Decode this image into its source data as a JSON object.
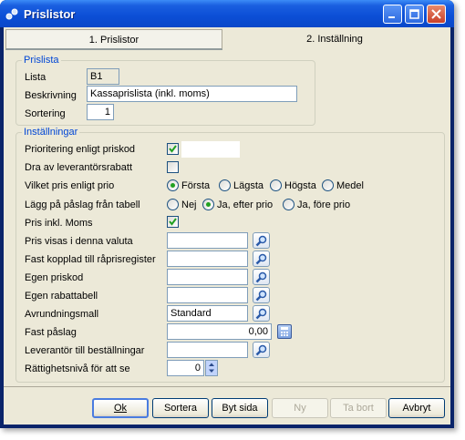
{
  "window": {
    "title": "Prislistor"
  },
  "tabs": [
    {
      "label": "1. Prislistor",
      "selected": false
    },
    {
      "label": "2. Inställning",
      "selected": true
    }
  ],
  "prislista": {
    "group_title": "Prislista",
    "lista_label": "Lista",
    "lista_value": "B1",
    "beskrivning_label": "Beskrivning",
    "beskrivning_value": "Kassaprislista (inkl. moms)",
    "sortering_label": "Sortering",
    "sortering_value": "1"
  },
  "installningar": {
    "group_title": "Inställningar",
    "prioritering_label": "Prioritering enligt priskod",
    "prioritering_checked": true,
    "leverantorsrabatt_label": "Dra av leverantörsrabatt",
    "leverantorsrabatt_checked": false,
    "vilket_pris_label": "Vilket pris enligt prio",
    "vilket_pris_options": [
      "Första",
      "Lägsta",
      "Högsta",
      "Medel"
    ],
    "vilket_pris_selected": "Första",
    "lagg_pa_label": "Lägg på påslag från tabell",
    "lagg_pa_options": [
      "Nej",
      "Ja, efter prio",
      "Ja, före prio"
    ],
    "lagg_pa_selected": "Ja, efter prio",
    "pris_inkl_moms_label": "Pris inkl. Moms",
    "pris_inkl_moms_checked": true,
    "valuta_label": "Pris visas i denna valuta",
    "valuta_value": "",
    "raprisregister_label": "Fast kopplad till råprisregister",
    "raprisregister_value": "",
    "egen_priskod_label": "Egen priskod",
    "egen_priskod_value": "",
    "egen_rabattabell_label": "Egen rabattabell",
    "egen_rabattabell_value": "",
    "avrundningsmall_label": "Avrundningsmall",
    "avrundningsmall_value": "Standard",
    "fast_paslag_label": "Fast påslag",
    "fast_paslag_value": "0,00",
    "leverantor_label": "Leverantör till beställningar",
    "leverantor_value": "",
    "rattighetsniva_label": "Rättighetsnivå för att se",
    "rattighetsniva_value": "0"
  },
  "buttons": {
    "ok": "Ok",
    "sortera": "Sortera",
    "byt_sida": "Byt sida",
    "ny": "Ny",
    "ta_bort": "Ta bort",
    "avbryt": "Avbryt"
  },
  "icons": {
    "app": "price-list-app-icon",
    "search": "magnifier-icon",
    "calculator": "calculator-icon",
    "spinner": "spinner-arrows-icon"
  },
  "colors": {
    "titlebar": "#0b4ed6",
    "group_title": "#0046d5",
    "dialog_bg": "#ece9d8",
    "check_mark": "#21a121"
  }
}
